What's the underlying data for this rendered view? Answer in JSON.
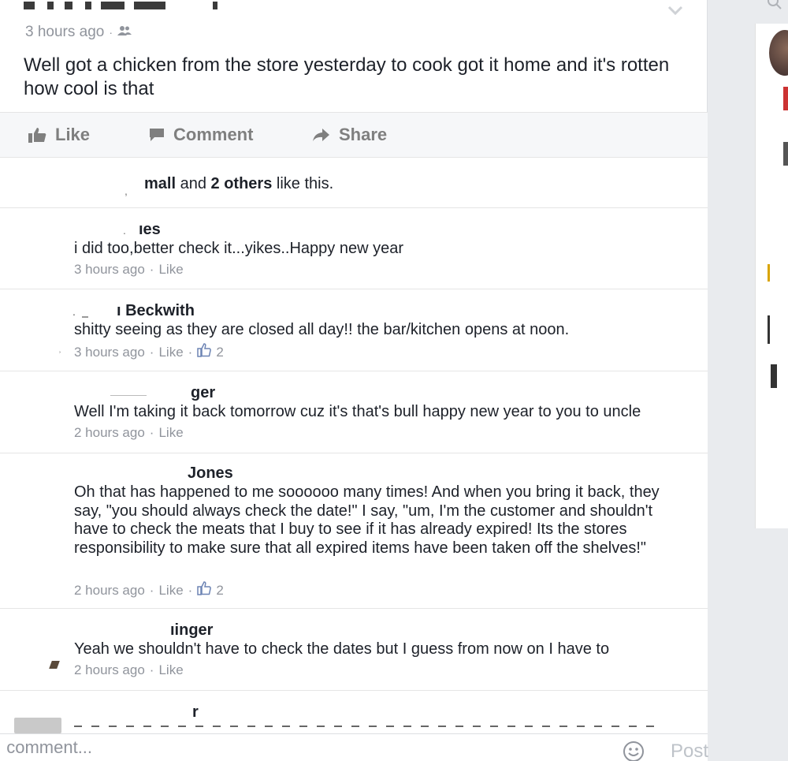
{
  "post": {
    "meta_time": "3 hours ago",
    "meta_dot": "·",
    "text": "Well got a chicken from the store yesterday to cook got it home and it's rotten how cool is that"
  },
  "actions": {
    "like": "Like",
    "comment": "Comment",
    "share": "Share"
  },
  "likes": {
    "name": "mall",
    "and": " and ",
    "others": "2 others",
    "suffix": " like this."
  },
  "comments": [
    {
      "author": "ıes",
      "body": "i did too,better check it...yikes..Happy new year",
      "time": "3 hours ago",
      "like": "Like",
      "count": ""
    },
    {
      "author": "ı Beckwith",
      "body": "shitty seeing as they are closed all day!!  the bar/kitchen opens at noon.",
      "time": "3 hours ago",
      "like": "Like",
      "count": "2"
    },
    {
      "author": "ger",
      "body": "Well I'm taking it back tomorrow cuz it's that's bull happy new year to you to uncle",
      "time": "2 hours ago",
      "like": "Like",
      "count": ""
    },
    {
      "author": "Jones",
      "body": "Oh that has happened to me soooooo many times!  And when you bring it back, they say, \"you should always check the date!\"  I say, \"um, I'm the customer and shouldn't have to check the meats that I buy to see if it has already expired!  Its the stores responsibility to make sure that all expired items have been taken off the shelves!\"",
      "time": "2 hours ago",
      "like": "Like",
      "count": "2"
    },
    {
      "author": "ıinger",
      "body": "Yeah we shouldn't have to check the dates but I guess from now on I have to",
      "time": "2 hours ago",
      "like": "Like",
      "count": ""
    },
    {
      "author": "r",
      "body": "",
      "time": "",
      "like": "",
      "count": ""
    }
  ],
  "compose": {
    "placeholder": "ı comment...",
    "post_label": "Post"
  },
  "colors": {
    "meta_gray": "#90949c",
    "action_gray": "#7f7f7f",
    "text": "#1d2129",
    "bg": "#e9ebee"
  },
  "icons": [
    "audience-friends-icon",
    "chevron-down-icon",
    "like-thumb-icon",
    "comment-bubble-icon",
    "share-arrow-icon",
    "thumbs-up-outline-icon",
    "emoji-icon",
    "search-icon"
  ]
}
